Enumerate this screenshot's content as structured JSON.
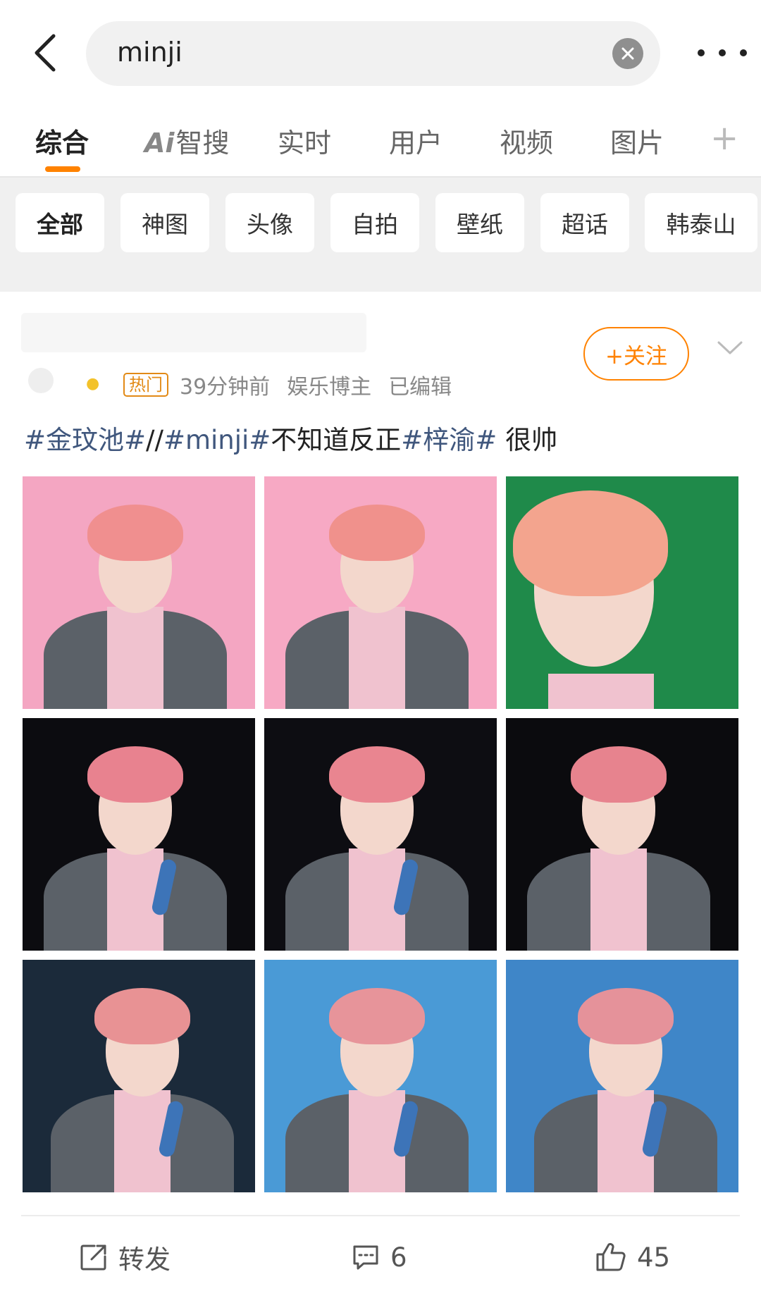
{
  "search": {
    "query": "minji"
  },
  "tabs": [
    {
      "label": "综合",
      "active": true
    },
    {
      "label": "智搜",
      "prefix": "Ai"
    },
    {
      "label": "实时"
    },
    {
      "label": "用户"
    },
    {
      "label": "视频"
    },
    {
      "label": "图片"
    }
  ],
  "chips": [
    "全部",
    "神图",
    "头像",
    "自拍",
    "壁纸",
    "超话",
    "韩泰山"
  ],
  "post": {
    "hot_tag": "热门",
    "time": "39分钟前",
    "category": "娱乐博主",
    "edited": "已编辑",
    "follow_label": "+关注",
    "text_segments": [
      {
        "text": "#金玟池#",
        "tag": true
      },
      {
        "text": "//",
        "tag": false
      },
      {
        "text": "#minji#",
        "tag": true
      },
      {
        "text": "不知道反正",
        "tag": false
      },
      {
        "text": "#梓渝#",
        "tag": true
      },
      {
        "text": " 很帅",
        "tag": false
      }
    ],
    "photos": [
      {
        "bg": "#f4a6c2",
        "hair": "#f08f8f"
      },
      {
        "bg": "#f7a9c4",
        "hair": "#f0918c"
      },
      {
        "bg": "#1f8a4a",
        "hair": "#f3a48e"
      },
      {
        "bg": "#0c0c10",
        "hair": "#e8828f"
      },
      {
        "bg": "#0d0d12",
        "hair": "#e98590"
      },
      {
        "bg": "#0b0b0e",
        "hair": "#e7838e"
      },
      {
        "bg": "#1b2a3a",
        "hair": "#e89294"
      },
      {
        "bg": "#4a9ad6",
        "hair": "#e7949a"
      },
      {
        "bg": "#3f86c8",
        "hair": "#e5929a"
      }
    ],
    "actions": {
      "repost_label": "转发",
      "comment_count": "6",
      "like_count": "45"
    }
  },
  "colors": {
    "accent": "#ff8200",
    "tag": "#40577d"
  }
}
